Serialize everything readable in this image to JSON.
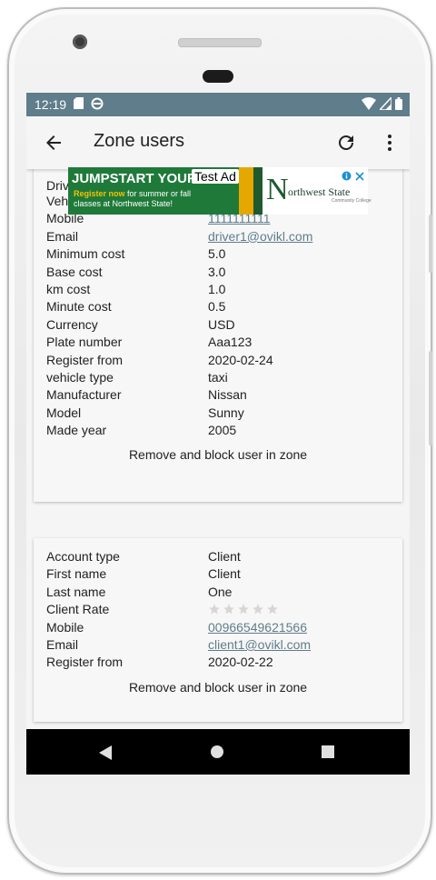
{
  "statusbar": {
    "time": "12:19"
  },
  "appbar": {
    "title": "Zone users"
  },
  "ad": {
    "headline": "JUMPSTART YOUR F",
    "line1_highlight": "Register now",
    "line1_rest": " for summer or fall",
    "line2": "classes at Northwest State!",
    "badge": "Test Ad",
    "logo_initial": "N",
    "logo_text": "orthwest State",
    "logo_subtext": "Community College"
  },
  "driver": {
    "partial_label": "Driver rate",
    "rows": [
      {
        "label": "Vehicle rate",
        "value": "",
        "stars": true,
        "link": false
      },
      {
        "label": "Mobile",
        "value": "1111111111",
        "stars": false,
        "link": true
      },
      {
        "label": "Email",
        "value": "driver1@ovikl.com",
        "stars": false,
        "link": true
      },
      {
        "label": "Minimum cost",
        "value": "5.0",
        "stars": false,
        "link": false
      },
      {
        "label": "Base cost",
        "value": "3.0",
        "stars": false,
        "link": false
      },
      {
        "label": "km cost",
        "value": "1.0",
        "stars": false,
        "link": false
      },
      {
        "label": "Minute cost",
        "value": "0.5",
        "stars": false,
        "link": false
      },
      {
        "label": "Currency",
        "value": "USD",
        "stars": false,
        "link": false
      },
      {
        "label": "Plate number",
        "value": "Aaa123",
        "stars": false,
        "link": false
      },
      {
        "label": "Register from",
        "value": "2020-02-24",
        "stars": false,
        "link": false
      },
      {
        "label": "vehicle type",
        "value": "taxi",
        "stars": false,
        "link": false
      },
      {
        "label": "Manufacturer",
        "value": "Nissan",
        "stars": false,
        "link": false
      },
      {
        "label": "Model",
        "value": "Sunny",
        "stars": false,
        "link": false
      },
      {
        "label": "Made year",
        "value": "2005",
        "stars": false,
        "link": false
      }
    ],
    "action": "Remove and block user in zone"
  },
  "client": {
    "rows": [
      {
        "label": "Account type",
        "value": "Client",
        "stars": false,
        "link": false
      },
      {
        "label": "First name",
        "value": "Client",
        "stars": false,
        "link": false
      },
      {
        "label": "Last name",
        "value": "One",
        "stars": false,
        "link": false
      },
      {
        "label": "Client Rate",
        "value": "",
        "stars": true,
        "link": false
      },
      {
        "label": "Mobile",
        "value": "00966549621566",
        "stars": false,
        "link": true
      },
      {
        "label": "Email",
        "value": "client1@ovikl.com",
        "stars": false,
        "link": true
      },
      {
        "label": "Register from",
        "value": "2020-02-22",
        "stars": false,
        "link": false
      }
    ],
    "action": "Remove and block user in zone"
  },
  "colors": {
    "accent": "#607d8b",
    "star_empty": "#d6d6d6",
    "ad_green": "#1f7a3a"
  }
}
